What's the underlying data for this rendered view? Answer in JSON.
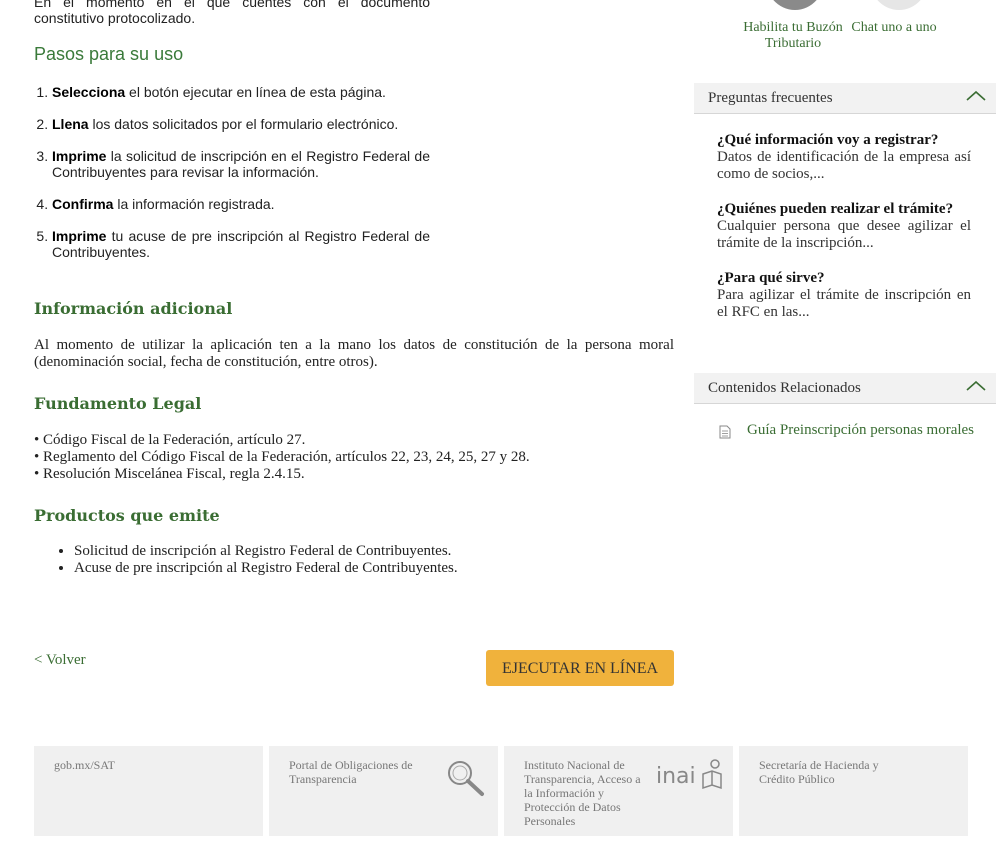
{
  "intro_fragment": "En el momento en el que cuentes con el documento constitutivo protocolizado.",
  "pasos": {
    "title": "Pasos para su uso",
    "steps": [
      {
        "bold": "Selecciona",
        "rest": " el botón ejecutar en línea de esta página."
      },
      {
        "bold": "Llena",
        "rest": " los datos solicitados por el formulario electrónico."
      },
      {
        "bold": "Imprime",
        "rest": " la solicitud de inscripción en el Registro Federal de Contribuyentes para revisar la información."
      },
      {
        "bold": "Confirma",
        "rest": " la información registrada."
      },
      {
        "bold": "Imprime",
        "rest": " tu acuse de pre inscripción al Registro Federal de Contribuyentes."
      }
    ]
  },
  "info_adicional": {
    "title": "Información adicional",
    "text": "Al momento de utilizar la aplicación ten a la mano los datos de constitución de la persona moral (denominación social, fecha de constitución, entre otros)."
  },
  "fundamento": {
    "title": "Fundamento Legal",
    "items": [
      "• Código Fiscal de la Federación, artículo 27.",
      "• Reglamento del Código Fiscal de la Federación, artículos 22, 23, 24, 25, 27 y 28.",
      "• Resolución Miscelánea Fiscal, regla 2.4.15."
    ]
  },
  "productos": {
    "title": "Productos que emite",
    "items": [
      "Solicitud de inscripción al Registro Federal de Contribuyentes.",
      "Acuse de pre inscripción al Registro Federal de Contribuyentes."
    ]
  },
  "actions": {
    "back": "< Volver",
    "execute": "EJECUTAR EN LÍNEA"
  },
  "quick_links": {
    "buzon": "Habilita tu Buzón Tributario",
    "chat": "Chat uno a uno"
  },
  "faq": {
    "title": "Preguntas frecuentes",
    "items": [
      {
        "q": "¿Qué información voy a registrar?",
        "a": "Datos de identificación de la empresa así como de socios,..."
      },
      {
        "q": "¿Quiénes pueden realizar el trámite?",
        "a": "Cualquier persona que desee agilizar el trámite de la inscripción..."
      },
      {
        "q": "¿Para qué sirve?",
        "a": "Para agilizar el trámite de inscripción en el RFC en las..."
      }
    ]
  },
  "related": {
    "title": "Contenidos Relacionados",
    "link": "Guía Preinscripción personas morales"
  },
  "footer": {
    "gob": "gob.mx/SAT",
    "portal": "Portal de Obligaciones de Transparencia",
    "inai_text": "Instituto Nacional de Transparencia, Acceso a la Información y Protección de Datos Personales",
    "inai_logo": "inai",
    "shcp": "Secretaría de Hacienda y Crédito Público"
  },
  "colors": {
    "green": "#3a6d33",
    "button": "#f0b23c",
    "footer_bg": "#f0f0f0"
  }
}
